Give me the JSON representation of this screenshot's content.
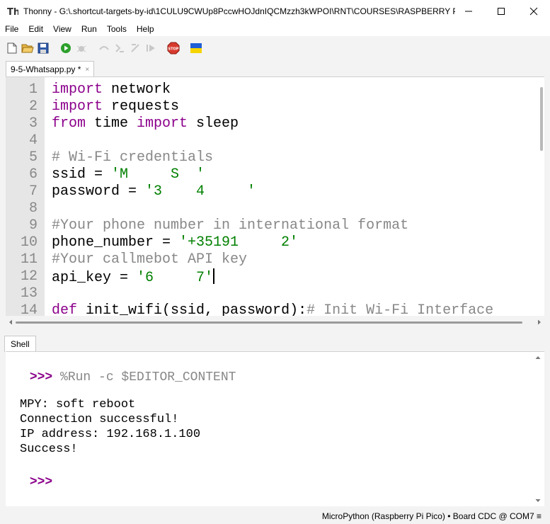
{
  "window": {
    "title": "Thonny  -  G:\\.shortcut-targets-by-id\\1CULU9CWUp8PccwHOJdnIQCMzzh3kWPOI\\RNT\\COURSES\\RASPBERRY PI..."
  },
  "menu": [
    "File",
    "Edit",
    "View",
    "Run",
    "Tools",
    "Help"
  ],
  "toolbar": {
    "icons": [
      "new-file-icon",
      "open-file-icon",
      "save-icon",
      "run-icon",
      "debug-icon",
      "step-over-icon",
      "step-into-icon",
      "step-out-icon",
      "resume-icon",
      "stop-icon",
      "ukraine-flag-icon"
    ],
    "stop_label": "STOP"
  },
  "editor": {
    "tab_label": "9-5-Whatsapp.py *",
    "tab_close": "×",
    "lines": [
      {
        "n": "1",
        "parts": [
          {
            "t": "import",
            "c": "kw"
          },
          {
            "t": " network",
            "c": "tx"
          }
        ]
      },
      {
        "n": "2",
        "parts": [
          {
            "t": "import",
            "c": "kw"
          },
          {
            "t": " requests",
            "c": "tx"
          }
        ]
      },
      {
        "n": "3",
        "parts": [
          {
            "t": "from",
            "c": "kw"
          },
          {
            "t": " time ",
            "c": "tx"
          },
          {
            "t": "import",
            "c": "kw"
          },
          {
            "t": " sleep",
            "c": "tx"
          }
        ]
      },
      {
        "n": "4",
        "parts": []
      },
      {
        "n": "5",
        "parts": [
          {
            "t": "# Wi-Fi credentials",
            "c": "cm"
          }
        ]
      },
      {
        "n": "6",
        "parts": [
          {
            "t": "ssid = ",
            "c": "tx"
          },
          {
            "t": "'M     S  '",
            "c": "st"
          }
        ]
      },
      {
        "n": "7",
        "parts": [
          {
            "t": "password = ",
            "c": "tx"
          },
          {
            "t": "'3    4     '",
            "c": "st"
          }
        ]
      },
      {
        "n": "8",
        "parts": []
      },
      {
        "n": "9",
        "parts": [
          {
            "t": "#Your phone number in international format",
            "c": "cm"
          }
        ]
      },
      {
        "n": "10",
        "parts": [
          {
            "t": "phone_number = ",
            "c": "tx"
          },
          {
            "t": "'+35191     2'",
            "c": "st"
          }
        ]
      },
      {
        "n": "11",
        "parts": [
          {
            "t": "#Your callmebot API key",
            "c": "cm"
          }
        ]
      },
      {
        "n": "12",
        "parts": [
          {
            "t": "api_key = ",
            "c": "tx"
          },
          {
            "t": "'6     7'",
            "c": "st"
          }
        ]
      },
      {
        "n": "13",
        "parts": []
      },
      {
        "n": "14",
        "parts": [
          {
            "t": "def",
            "c": "kw"
          },
          {
            "t": " init_wifi(ssid, password):",
            "c": "tx"
          },
          {
            "t": "# Init Wi-Fi Interface",
            "c": "cm"
          }
        ]
      }
    ]
  },
  "shell": {
    "tab_label": "Shell",
    "prompt": ">>>",
    "command": " %Run -c $EDITOR_CONTENT",
    "output": [
      "MPY: soft reboot",
      "Connection successful!",
      "IP address: 192.168.1.100",
      "Success!"
    ]
  },
  "status": {
    "interpreter": "MicroPython (Raspberry Pi Pico)  •  Board CDC @ COM7  ≡"
  }
}
